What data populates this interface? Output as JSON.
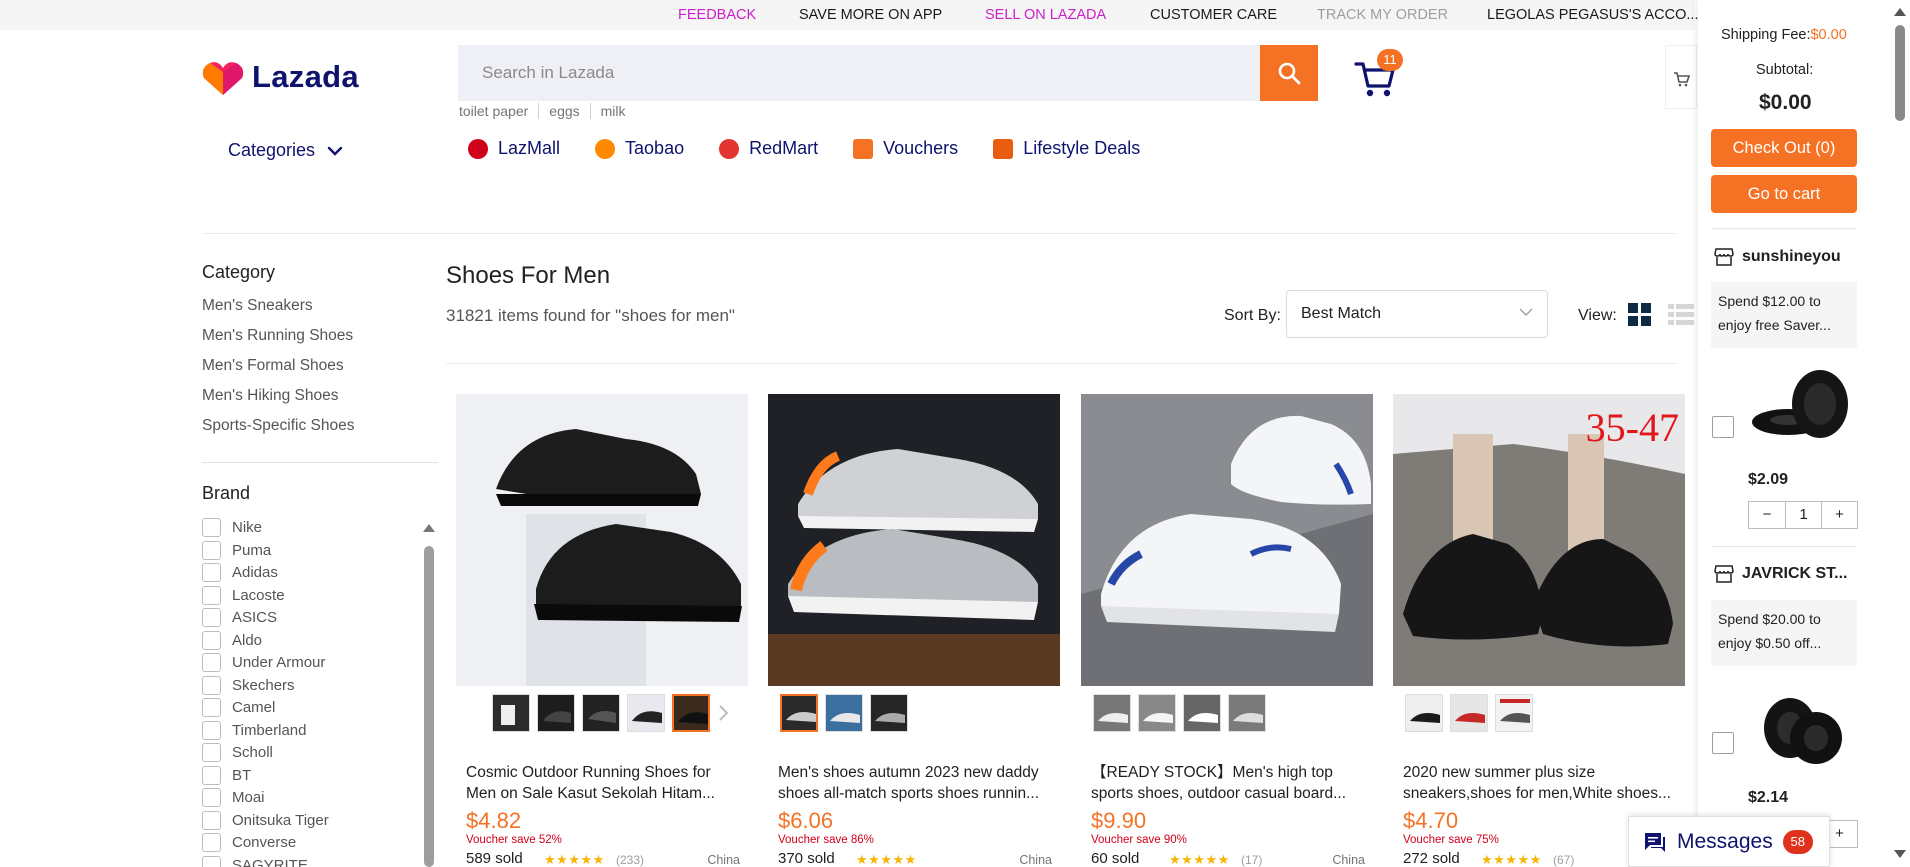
{
  "topbar": {
    "feedback": "FEEDBACK",
    "save_more": "SAVE MORE ON APP",
    "sell": "SELL ON LAZADA",
    "customer_care": "CUSTOMER CARE",
    "track_order": "TRACK MY ORDER",
    "account": "LEGOLAS PEGASUS'S ACCO..."
  },
  "header": {
    "logo_text": "Lazada",
    "search_placeholder": "Search in Lazada",
    "suggestions": [
      "toilet paper",
      "eggs",
      "milk"
    ],
    "cart_count": "11",
    "categories_label": "Categories"
  },
  "quicknav": [
    {
      "label": "LazMall",
      "color": "#d0011b"
    },
    {
      "label": "Taobao",
      "color": "#ff6a00"
    },
    {
      "label": "RedMart",
      "color": "#e3342f"
    },
    {
      "label": "Vouchers",
      "color": "#f57224"
    },
    {
      "label": "Lifestyle Deals",
      "color": "#e85d0f"
    }
  ],
  "sidebar": {
    "category_title": "Category",
    "categories": [
      "Men's Sneakers",
      "Men's Running Shoes",
      "Men's Formal Shoes",
      "Men's Hiking Shoes",
      "Sports-Specific Shoes"
    ],
    "brand_title": "Brand",
    "brands": [
      "Nike",
      "Puma",
      "Adidas",
      "Lacoste",
      "ASICS",
      "Aldo",
      "Under Armour",
      "Skechers",
      "Camel",
      "Timberland",
      "Scholl",
      "BT",
      "Moai",
      "Onitsuka Tiger",
      "Converse",
      "SAGYRITE"
    ]
  },
  "results": {
    "title": "Shoes For Men",
    "count": "31821 items found for \"shoes for men\"",
    "sort_label": "Sort By:",
    "sort_value": "Best Match",
    "view_label": "View:"
  },
  "products": [
    {
      "title": "Cosmic Outdoor Running Shoes for Men on Sale Kasut Sekolah Hitam...",
      "price": "$4.82",
      "voucher": "Voucher save 52%",
      "sold": "589 sold",
      "stars": "★★★★★",
      "reviews": "(233)",
      "country": "China",
      "thumbs": 5
    },
    {
      "title": "Men's shoes autumn 2023 new daddy shoes all-match sports shoes runnin...",
      "price": "$6.06",
      "voucher": "Voucher save 86%",
      "sold": "370 sold",
      "stars": "★★★★★",
      "reviews": "",
      "country": "China",
      "thumbs": 3
    },
    {
      "title": "【READY STOCK】Men's high top sports shoes, outdoor casual board...",
      "price": "$9.90",
      "voucher": "Voucher save 90%",
      "sold": "60 sold",
      "stars": "★★★★★",
      "reviews": "(17)",
      "country": "China",
      "thumbs": 4
    },
    {
      "title": "2020 new summer plus size sneakers,shoes for men,White shoes...",
      "price": "$4.70",
      "voucher": "Voucher save 75%",
      "sold": "272 sold",
      "stars": "★★★★★",
      "reviews": "(67)",
      "country": "",
      "thumbs": 3,
      "badge": "35-47"
    }
  ],
  "cart_panel": {
    "shipping_label": "Shipping Fee:",
    "shipping_value": "$0.00",
    "subtotal_label": "Subtotal:",
    "subtotal_value": "$0.00",
    "checkout": "Check Out (0)",
    "go_to_cart": "Go to cart",
    "stores": [
      {
        "name": "sunshineyou",
        "promo": "Spend $12.00 to enjoy free Saver...",
        "price": "$2.09",
        "qty": "1"
      },
      {
        "name": "JAVRICK ST...",
        "promo": "Spend $20.00 to enjoy $0.50 off...",
        "price": "$2.14",
        "qty": "1"
      }
    ]
  },
  "messages": {
    "label": "Messages",
    "count": "58"
  },
  "colors": {
    "brand_orange": "#f57224",
    "navy": "#0f136d",
    "pink": "#cc1ec9",
    "voucher_red": "#d0011b"
  }
}
